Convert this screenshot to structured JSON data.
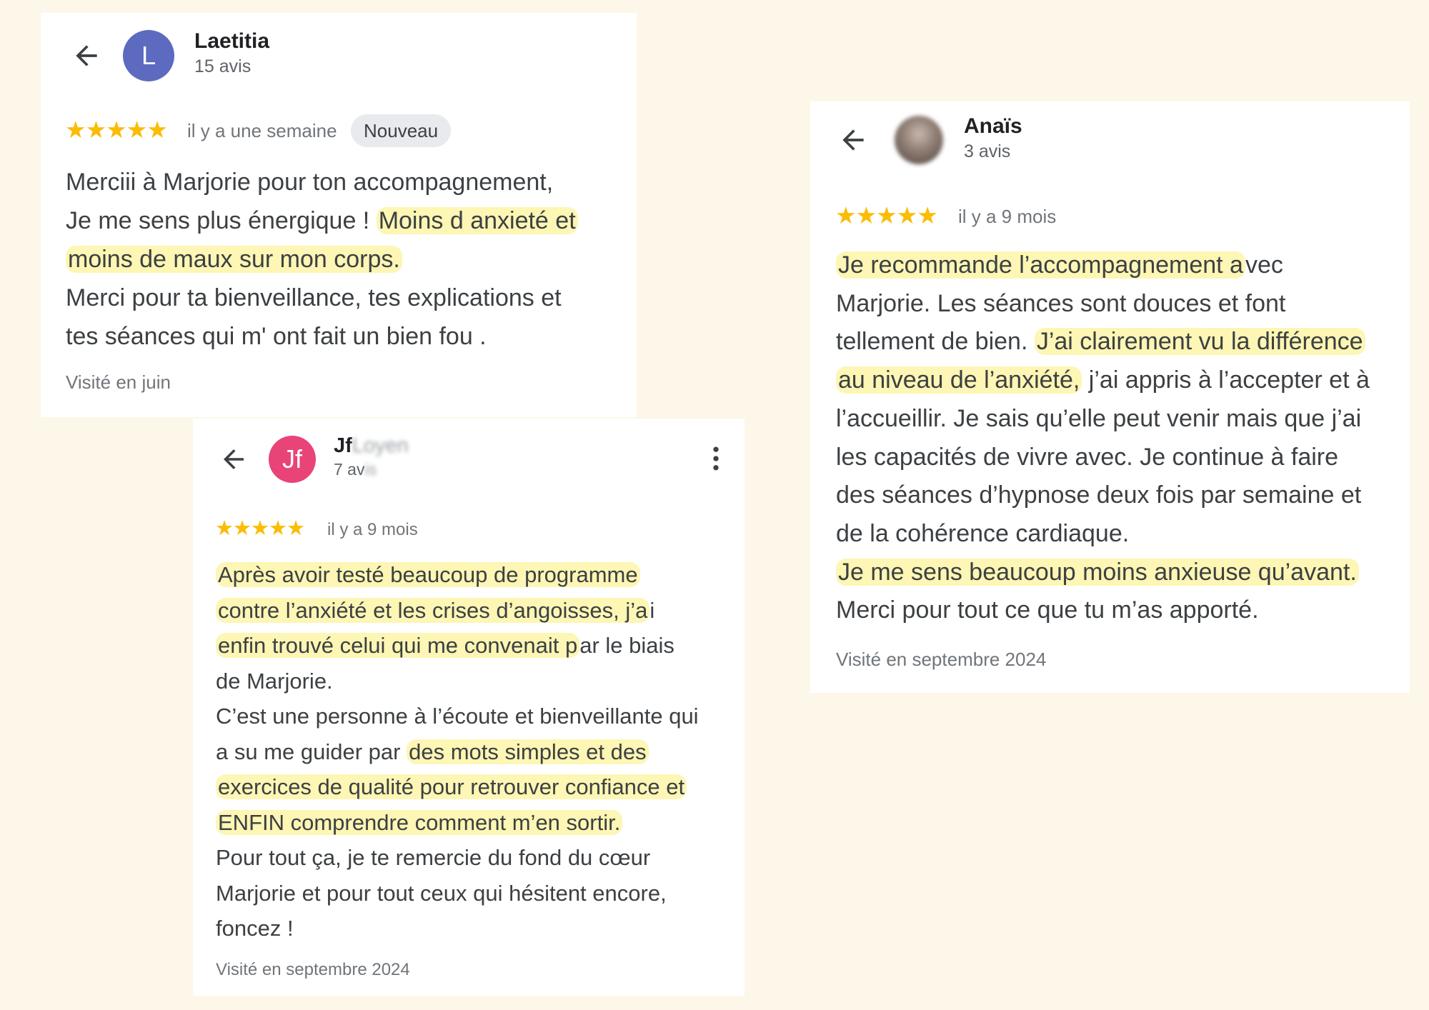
{
  "colors": {
    "background": "#fcf7e8",
    "card": "#ffffff",
    "star": "#fbbc04",
    "highlight": "#fdf6b4",
    "avatar_laetitia": "#5c6bc0",
    "avatar_jf": "#e84477"
  },
  "reviews": [
    {
      "reviewer": "Laetitia",
      "avatar_letter": "L",
      "review_count": "15 avis",
      "rating": 5,
      "stars": "★★★★★",
      "date": "il y a une semaine",
      "badge": "Nouveau",
      "lines": [
        [
          "Merciii à Marjorie pour ton accompagnement,"
        ],
        [
          "Je me sens plus énergique ! ",
          "Moins d anxieté et"
        ],
        [
          "moins de maux sur mon corps."
        ],
        [
          "Merci pour ta bienveillance, tes explications et"
        ],
        [
          "tes séances qui m' ont fait un bien fou ."
        ]
      ],
      "visited": "Visité en juin",
      "icons": [
        "back-arrow-icon"
      ]
    },
    {
      "reviewer": "Jf",
      "reviewer_blurred": "Loyen",
      "avatar_letter": "Jf",
      "review_count": "7 av",
      "review_count_blurred": "is",
      "rating": 5,
      "stars": "★★★★★",
      "date": "il y a 9 mois",
      "lines": [
        [
          "Après avoir testé beaucoup de programme"
        ],
        [
          "contre l’anxiété et les crises d’angoisses, j’a",
          "i"
        ],
        [
          "enfin trouvé celui qui me convenait p",
          "ar le biais"
        ],
        [
          "de Marjorie."
        ],
        [
          "C’est une personne à l’écoute et bienveillante qui"
        ],
        [
          "a su me guider par ",
          "des mots simples et des"
        ],
        [
          "exercices de qualité pour retrouver confiance et"
        ],
        [
          "ENFIN comprendre comment m’en sortir."
        ],
        [
          "Pour tout ça, je te remercie du fond du cœur"
        ],
        [
          "Marjorie et pour tout ceux qui hésitent encore,"
        ],
        [
          "foncez !"
        ]
      ],
      "visited": "Visité en septembre 2024",
      "icons": [
        "back-arrow-icon",
        "more-vert-icon"
      ]
    },
    {
      "reviewer": "Anaïs",
      "review_count": "3 avis",
      "rating": 5,
      "stars": "★★★★★",
      "date": "il y a 9 mois",
      "lines": [
        [
          "Je recommande l’accompagnement a",
          "vec"
        ],
        [
          "Marjorie. Les séances sont douces et font"
        ],
        [
          "tellement de bien. ",
          "J’ai clairement vu la différence"
        ],
        [
          "au niveau de l’anxiété,",
          " j’ai appris à l’accepter et à"
        ],
        [
          "l’accueillir. Je sais qu’elle peut venir mais que j’ai"
        ],
        [
          "les capacités de vivre avec. Je continue à faire"
        ],
        [
          "des séances d’hypnose deux fois par semaine et"
        ],
        [
          "de la cohérence cardiaque."
        ],
        [
          "Je me sens beaucoup moins anxieuse qu’avant."
        ],
        [
          "Merci pour tout ce que tu m’as apporté."
        ]
      ],
      "visited": "Visité en septembre 2024",
      "icons": [
        "back-arrow-icon",
        "profile-photo-icon"
      ]
    }
  ]
}
